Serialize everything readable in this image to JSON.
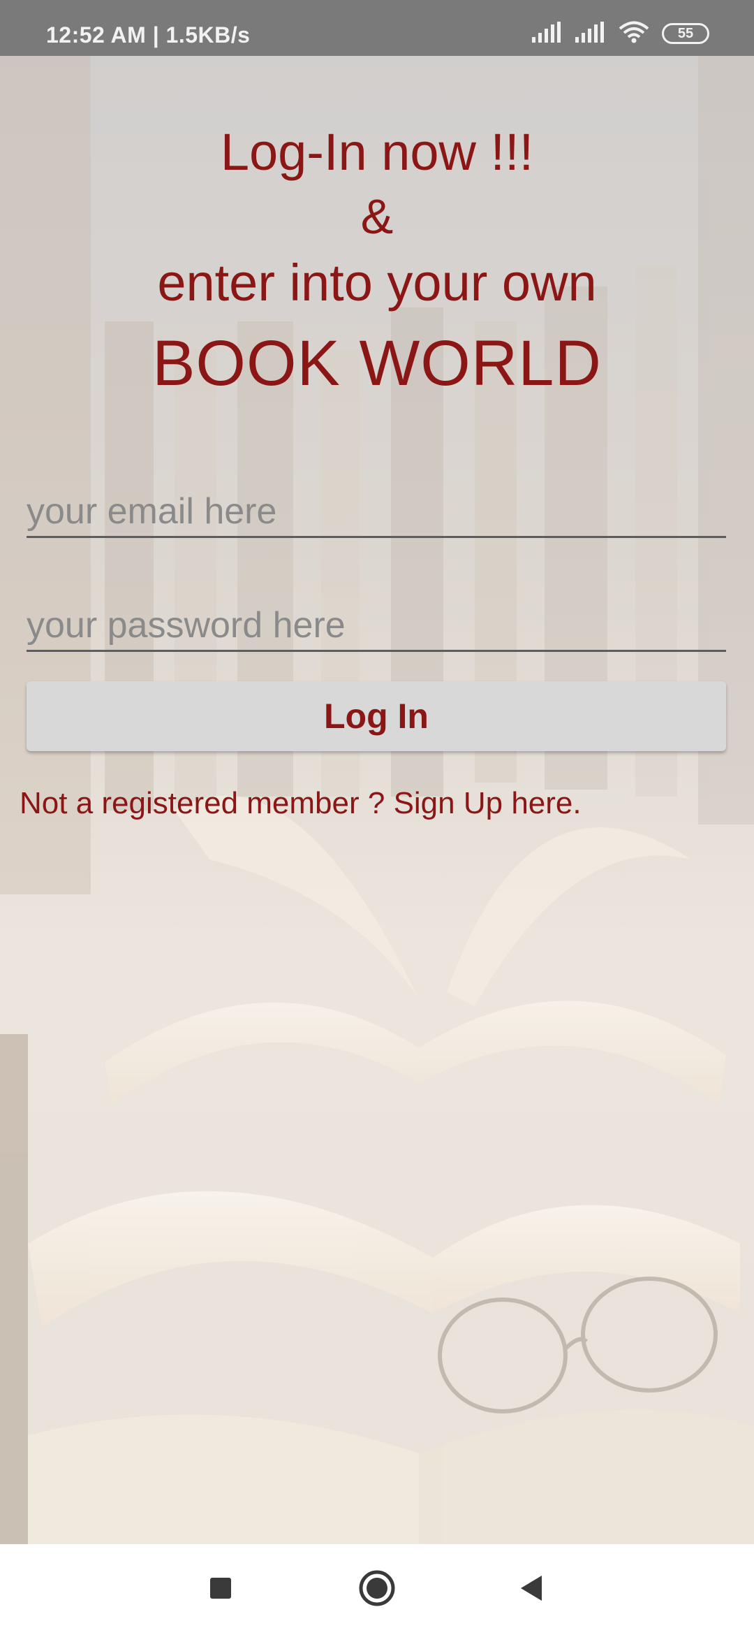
{
  "status_bar": {
    "time_speed": "12:52 AM | 1.5KB/s",
    "battery_level": "55",
    "icons": [
      "signal-icon",
      "signal-icon",
      "wifi-icon",
      "battery-icon"
    ]
  },
  "header": {
    "line1": "Log-In now !!!",
    "line2": "&",
    "line3": "enter into your own",
    "line4": "BOOK WORLD"
  },
  "form": {
    "email_placeholder": "your email here",
    "email_value": "",
    "password_placeholder": "your password here",
    "password_value": "",
    "login_label": "Log In"
  },
  "signup": {
    "text": "Not a registered member ? Sign Up here."
  },
  "nav_bar": {
    "icons": [
      "recents-icon",
      "home-icon",
      "back-icon"
    ]
  },
  "colors": {
    "accent": "#8b1616",
    "status_bar": "#7a7a7a",
    "button_bg": "#d8d8d8"
  }
}
